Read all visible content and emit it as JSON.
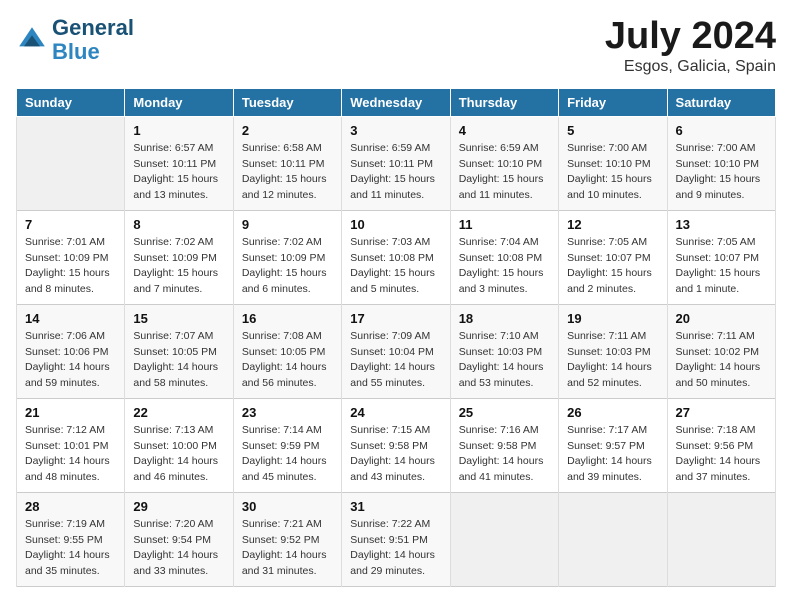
{
  "header": {
    "logo_line1": "General",
    "logo_line2": "Blue",
    "month_title": "July 2024",
    "location": "Esgos, Galicia, Spain"
  },
  "days_of_week": [
    "Sunday",
    "Monday",
    "Tuesday",
    "Wednesday",
    "Thursday",
    "Friday",
    "Saturday"
  ],
  "weeks": [
    [
      {
        "day": "",
        "info": ""
      },
      {
        "day": "1",
        "info": "Sunrise: 6:57 AM\nSunset: 10:11 PM\nDaylight: 15 hours\nand 13 minutes."
      },
      {
        "day": "2",
        "info": "Sunrise: 6:58 AM\nSunset: 10:11 PM\nDaylight: 15 hours\nand 12 minutes."
      },
      {
        "day": "3",
        "info": "Sunrise: 6:59 AM\nSunset: 10:11 PM\nDaylight: 15 hours\nand 11 minutes."
      },
      {
        "day": "4",
        "info": "Sunrise: 6:59 AM\nSunset: 10:10 PM\nDaylight: 15 hours\nand 11 minutes."
      },
      {
        "day": "5",
        "info": "Sunrise: 7:00 AM\nSunset: 10:10 PM\nDaylight: 15 hours\nand 10 minutes."
      },
      {
        "day": "6",
        "info": "Sunrise: 7:00 AM\nSunset: 10:10 PM\nDaylight: 15 hours\nand 9 minutes."
      }
    ],
    [
      {
        "day": "7",
        "info": "Sunrise: 7:01 AM\nSunset: 10:09 PM\nDaylight: 15 hours\nand 8 minutes."
      },
      {
        "day": "8",
        "info": "Sunrise: 7:02 AM\nSunset: 10:09 PM\nDaylight: 15 hours\nand 7 minutes."
      },
      {
        "day": "9",
        "info": "Sunrise: 7:02 AM\nSunset: 10:09 PM\nDaylight: 15 hours\nand 6 minutes."
      },
      {
        "day": "10",
        "info": "Sunrise: 7:03 AM\nSunset: 10:08 PM\nDaylight: 15 hours\nand 5 minutes."
      },
      {
        "day": "11",
        "info": "Sunrise: 7:04 AM\nSunset: 10:08 PM\nDaylight: 15 hours\nand 3 minutes."
      },
      {
        "day": "12",
        "info": "Sunrise: 7:05 AM\nSunset: 10:07 PM\nDaylight: 15 hours\nand 2 minutes."
      },
      {
        "day": "13",
        "info": "Sunrise: 7:05 AM\nSunset: 10:07 PM\nDaylight: 15 hours\nand 1 minute."
      }
    ],
    [
      {
        "day": "14",
        "info": "Sunrise: 7:06 AM\nSunset: 10:06 PM\nDaylight: 14 hours\nand 59 minutes."
      },
      {
        "day": "15",
        "info": "Sunrise: 7:07 AM\nSunset: 10:05 PM\nDaylight: 14 hours\nand 58 minutes."
      },
      {
        "day": "16",
        "info": "Sunrise: 7:08 AM\nSunset: 10:05 PM\nDaylight: 14 hours\nand 56 minutes."
      },
      {
        "day": "17",
        "info": "Sunrise: 7:09 AM\nSunset: 10:04 PM\nDaylight: 14 hours\nand 55 minutes."
      },
      {
        "day": "18",
        "info": "Sunrise: 7:10 AM\nSunset: 10:03 PM\nDaylight: 14 hours\nand 53 minutes."
      },
      {
        "day": "19",
        "info": "Sunrise: 7:11 AM\nSunset: 10:03 PM\nDaylight: 14 hours\nand 52 minutes."
      },
      {
        "day": "20",
        "info": "Sunrise: 7:11 AM\nSunset: 10:02 PM\nDaylight: 14 hours\nand 50 minutes."
      }
    ],
    [
      {
        "day": "21",
        "info": "Sunrise: 7:12 AM\nSunset: 10:01 PM\nDaylight: 14 hours\nand 48 minutes."
      },
      {
        "day": "22",
        "info": "Sunrise: 7:13 AM\nSunset: 10:00 PM\nDaylight: 14 hours\nand 46 minutes."
      },
      {
        "day": "23",
        "info": "Sunrise: 7:14 AM\nSunset: 9:59 PM\nDaylight: 14 hours\nand 45 minutes."
      },
      {
        "day": "24",
        "info": "Sunrise: 7:15 AM\nSunset: 9:58 PM\nDaylight: 14 hours\nand 43 minutes."
      },
      {
        "day": "25",
        "info": "Sunrise: 7:16 AM\nSunset: 9:58 PM\nDaylight: 14 hours\nand 41 minutes."
      },
      {
        "day": "26",
        "info": "Sunrise: 7:17 AM\nSunset: 9:57 PM\nDaylight: 14 hours\nand 39 minutes."
      },
      {
        "day": "27",
        "info": "Sunrise: 7:18 AM\nSunset: 9:56 PM\nDaylight: 14 hours\nand 37 minutes."
      }
    ],
    [
      {
        "day": "28",
        "info": "Sunrise: 7:19 AM\nSunset: 9:55 PM\nDaylight: 14 hours\nand 35 minutes."
      },
      {
        "day": "29",
        "info": "Sunrise: 7:20 AM\nSunset: 9:54 PM\nDaylight: 14 hours\nand 33 minutes."
      },
      {
        "day": "30",
        "info": "Sunrise: 7:21 AM\nSunset: 9:52 PM\nDaylight: 14 hours\nand 31 minutes."
      },
      {
        "day": "31",
        "info": "Sunrise: 7:22 AM\nSunset: 9:51 PM\nDaylight: 14 hours\nand 29 minutes."
      },
      {
        "day": "",
        "info": ""
      },
      {
        "day": "",
        "info": ""
      },
      {
        "day": "",
        "info": ""
      }
    ]
  ]
}
